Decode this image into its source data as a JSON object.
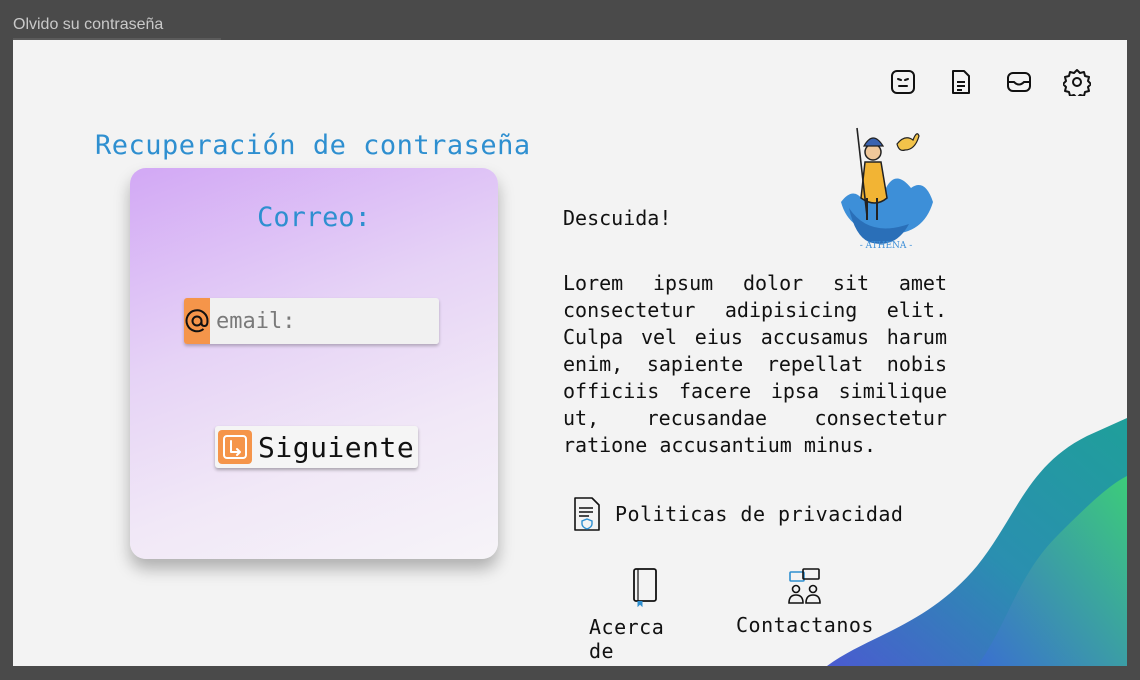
{
  "window": {
    "title": "Olvido su contraseña"
  },
  "toolbar": {
    "icons": [
      "face-icon",
      "document-icon",
      "inbox-icon",
      "settings-icon"
    ]
  },
  "page_title": "Recuperación de contraseña",
  "card": {
    "label": "Correo:",
    "email_placeholder": "email:",
    "next_label": "Siguiente"
  },
  "content": {
    "subheading": "Descuida!",
    "paragraph": "Lorem ipsum dolor sit amet consectetur adipisicing elit. Culpa vel eius accusamus harum enim, sapiente repellat nobis officiis facere ipsa similique ut, recusandae consectetur ratione accusantium minus."
  },
  "logo": {
    "text": "- ATHENA -"
  },
  "links": {
    "privacy": "Politicas de privacidad",
    "about": "Acerca de",
    "contact": "Contactanos"
  },
  "colors": {
    "accent_blue": "#2e8fd0",
    "accent_orange": "#f5954a",
    "card_purple": "#d2a8f5"
  }
}
